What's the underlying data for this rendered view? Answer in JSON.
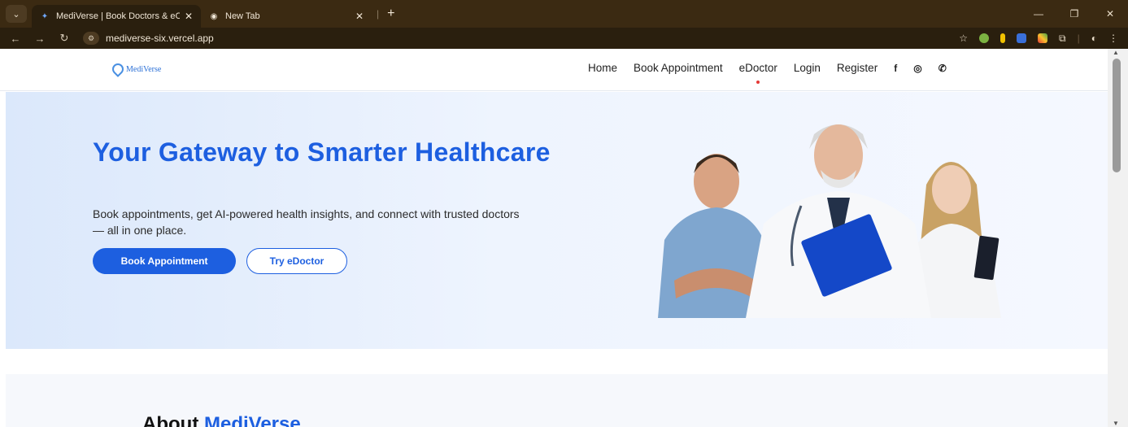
{
  "browser": {
    "tabs": [
      {
        "title": "MediVerse | Book Doctors & eC",
        "active": true
      },
      {
        "title": "New Tab",
        "active": false
      }
    ],
    "url": "mediverse-six.vercel.app",
    "new_tab_symbol": "+",
    "nav_icons": [
      "back-icon",
      "forward-icon",
      "reload-icon"
    ]
  },
  "site": {
    "logo_text": "MediVerse",
    "nav": [
      {
        "label": "Home"
      },
      {
        "label": "Book Appointment"
      },
      {
        "label": "eDoctor",
        "active": true
      },
      {
        "label": "Login"
      },
      {
        "label": "Register"
      }
    ],
    "social_icons": [
      "facebook-icon",
      "instagram-icon",
      "whatsapp-icon"
    ]
  },
  "hero": {
    "title": "Your Gateway to Smarter Healthcare",
    "subtitle": "Book appointments, get AI-powered health insights, and connect with trusted doctors — all in one place.",
    "primary_button": "Book Appointment",
    "secondary_button": "Try eDoctor"
  },
  "about": {
    "title_prefix": "About ",
    "title_brand": "MediVerse"
  },
  "colors": {
    "brand": "#1d5fe0",
    "chrome_dark": "#2a1f0e",
    "chrome_tabbar": "#3b2a12"
  }
}
